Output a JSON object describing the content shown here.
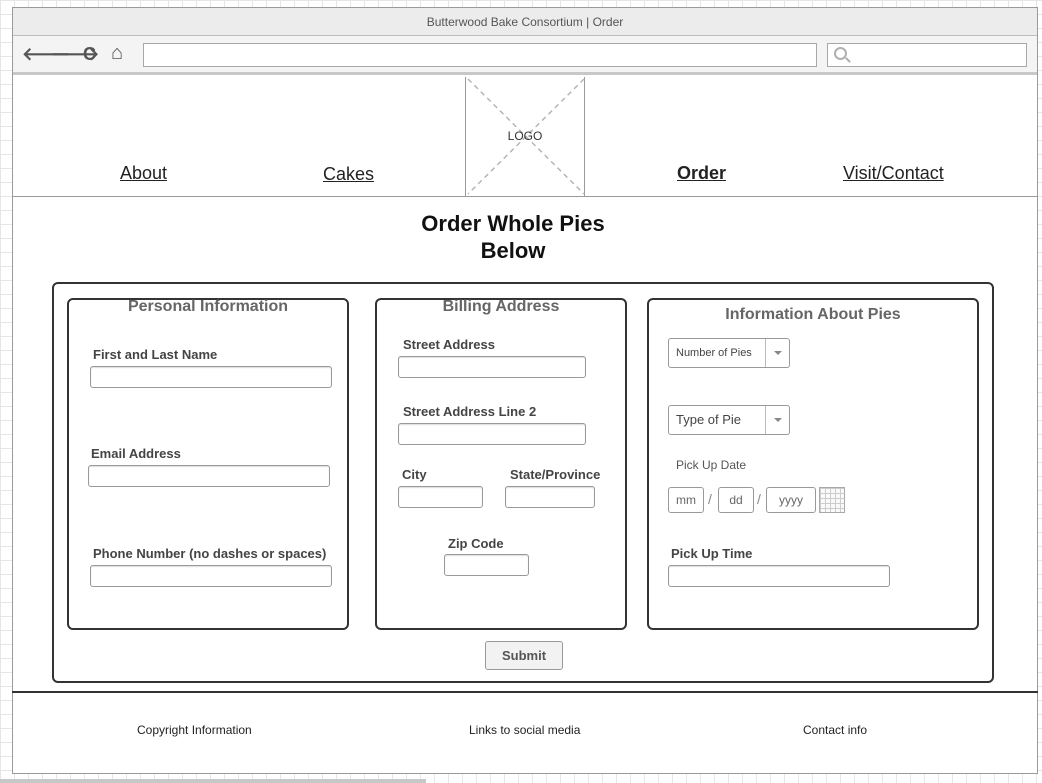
{
  "window": {
    "title": "Butterwood Bake Consortium | Order"
  },
  "toolbar": {
    "icons": [
      "back-arrow-icon",
      "forward-arrow-icon",
      "reload-icon",
      "home-icon",
      "search-icon"
    ],
    "back_glyph": "🡐",
    "forward_glyph": "🡒",
    "reload_glyph": "C",
    "home_glyph": "⌂",
    "address_value": "",
    "search_value": ""
  },
  "header": {
    "nav": {
      "about": "About",
      "cakes": "Cakes",
      "order": "Order",
      "visit": "Visit/Contact"
    },
    "logo_text": "LOGO"
  },
  "main": {
    "title_line1": "Order Whole Pies",
    "title_line2": "Below"
  },
  "personal": {
    "title": "Personal Information",
    "name_label": "First and Last Name",
    "name_value": "",
    "email_label": "Email Address",
    "email_value": "",
    "phone_label": "Phone Number (no dashes or spaces)",
    "phone_value": ""
  },
  "billing": {
    "title": "Billing Address",
    "street_label": "Street Address",
    "street2_label": "Street Address Line 2",
    "city_label": "City",
    "state_label": "State/Province",
    "zip_label": "Zip Code"
  },
  "pies": {
    "title": "Information About Pies",
    "number_select": "Number of Pies",
    "type_select": "Type of Pie",
    "date_label": "Pick Up Date",
    "date_mm": "mm",
    "date_dd": "dd",
    "date_yyyy": "yyyy",
    "date_sep": "/",
    "time_label": "Pick Up Time"
  },
  "form": {
    "submit_label": "Submit"
  },
  "footer": {
    "copyright": "Copyright Information",
    "social": "Links to social media",
    "contact": "Contact info"
  }
}
